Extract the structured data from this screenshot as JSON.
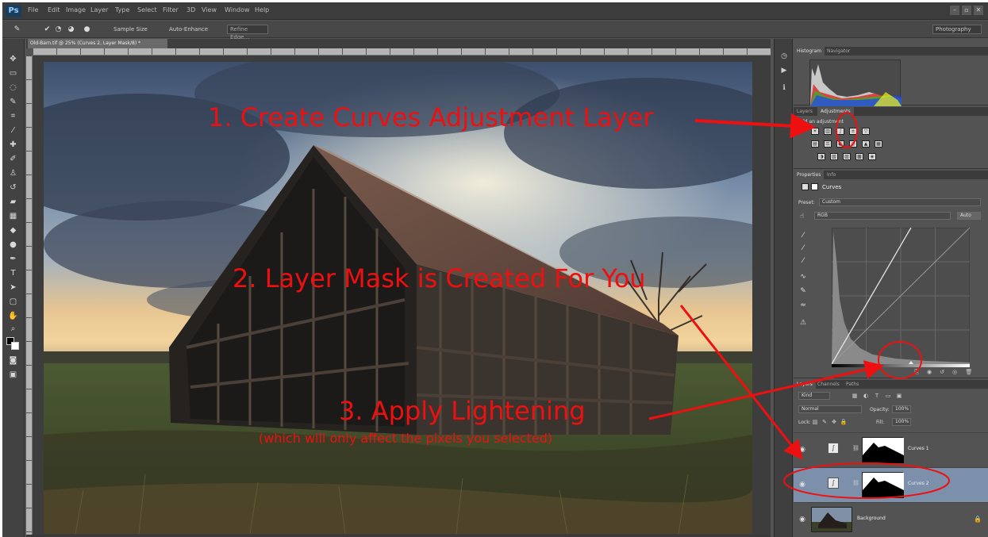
{
  "app": {
    "logo": "Ps",
    "menus": [
      "File",
      "Edit",
      "Image",
      "Layer",
      "Type",
      "Select",
      "Filter",
      "3D",
      "View",
      "Window",
      "Help"
    ],
    "window_controls": [
      "–",
      "▫",
      "✕"
    ]
  },
  "options_bar": {
    "sample_all_layers": "Sample Size",
    "auto_enhance": "Auto-Enhance",
    "refine_edge": "Refine Edge...",
    "workspace": "Photography"
  },
  "document": {
    "tab_title": "Old-Barn.tif @ 25% (Curves 2, Layer Mask/8) *"
  },
  "panels": {
    "histogram": {
      "tabs": [
        "Histogram",
        "Navigator"
      ]
    },
    "adjustments": {
      "tabs": [
        "Layers",
        "Adjustments"
      ],
      "add_label": "Add an adjustment"
    },
    "properties": {
      "tabs": [
        "Properties",
        "Info"
      ],
      "type_label": "Curves",
      "preset_label": "Preset:",
      "preset_value": "Custom",
      "channel_value": "RGB",
      "auto_button": "Auto"
    },
    "layers": {
      "tabs": [
        "Layers",
        "Channels",
        "Paths"
      ],
      "kind_filter": "Kind",
      "blend_mode": "Normal",
      "opacity_label": "Opacity:",
      "opacity_value": "100%",
      "lock_label": "Lock:",
      "fill_label": "Fill:",
      "fill_value": "100%",
      "items": [
        {
          "name": "Curves 1",
          "selected": false
        },
        {
          "name": "Curves 2",
          "selected": true
        },
        {
          "name": "Background",
          "selected": false
        }
      ]
    }
  },
  "annotations": {
    "step1": "1. Create Curves Adjustment Layer",
    "step2": "2. Layer Mask is Created For You",
    "step3": "3. Apply Lightening",
    "step3_sub": "(which will only affect the pixels you selected)",
    "color": "#ee1010"
  },
  "icons": [
    "move-tool-icon",
    "marquee-tool-icon",
    "lasso-tool-icon",
    "quick-select-tool-icon",
    "crop-tool-icon",
    "eyedropper-tool-icon",
    "healing-brush-icon",
    "brush-tool-icon",
    "clone-stamp-icon",
    "history-brush-icon",
    "eraser-tool-icon",
    "gradient-tool-icon",
    "blur-tool-icon",
    "dodge-tool-icon",
    "pen-tool-icon",
    "type-tool-icon",
    "path-select-icon",
    "shape-tool-icon",
    "hand-tool-icon",
    "zoom-tool-icon",
    "eye-icon",
    "lock-icon",
    "curves-icon"
  ]
}
